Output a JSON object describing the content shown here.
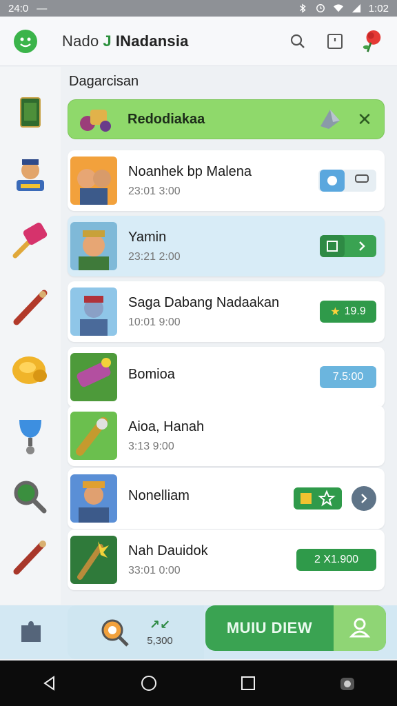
{
  "status_bar": {
    "time_left": "24:0",
    "time_right": "1:02"
  },
  "app": {
    "title_part1": "Nado",
    "title_mid": "J",
    "title_part2": "INadansia"
  },
  "section_title": "Dagarcisan",
  "featured": {
    "title": "Redodiakaa"
  },
  "items": [
    {
      "name": "Noanhek bp Malena",
      "time": "23:01 3:00",
      "pill": ""
    },
    {
      "name": "Yamin",
      "time": "23:21 2:00",
      "pill": ""
    },
    {
      "name": "Saga Dabang Nadaakan",
      "time": "10:01 9:00",
      "pill": "19.9"
    },
    {
      "name": "Bomioa",
      "time": "",
      "pill": "7.5:00"
    },
    {
      "name": "Aioa, Hanah",
      "time": "3:13 9:00",
      "pill": ""
    },
    {
      "name": "Nonelliam",
      "time": "",
      "pill": ""
    },
    {
      "name": "Nah Dauidok",
      "time": "33:01 0:00",
      "pill": "2 X1.900"
    }
  ],
  "bottom_bar": {
    "count_label": "5,300",
    "cta_label": "MUIU DIEW"
  },
  "colors": {
    "accent_green": "#3aa352",
    "light_green": "#8fd96b",
    "selected_blue": "#d8ecf7",
    "pill_blue": "#6bb5de"
  }
}
